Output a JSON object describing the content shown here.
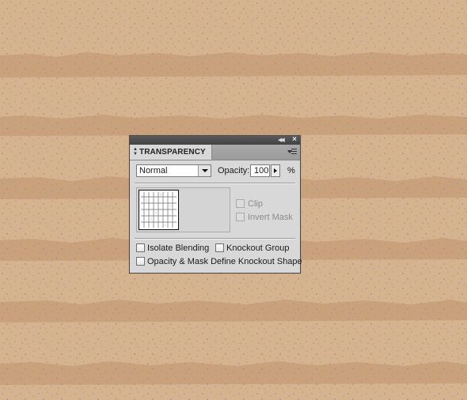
{
  "colors": {
    "background_sand": "#d6b38f",
    "background_stripe": "#c8a079",
    "speckle": "#9d8fa5",
    "panel_bg": "#d8d8d8",
    "title_bar": "#4a4a4a"
  },
  "panel": {
    "title": "TRANSPARENCY",
    "icons": {
      "collapse": "double-chevron-left-icon",
      "close": "close-icon",
      "menu": "panel-menu-icon",
      "tab_arrows": "up-down-arrows-icon"
    },
    "blend_mode": {
      "value": "Normal"
    },
    "opacity": {
      "label": "Opacity:",
      "value": "100",
      "unit": "%"
    },
    "mask_options": {
      "clip": {
        "label": "Clip",
        "checked": false,
        "enabled": false
      },
      "invert_mask": {
        "label": "Invert Mask",
        "checked": false,
        "enabled": false
      }
    },
    "options": {
      "isolate_blending": {
        "label": "Isolate Blending",
        "checked": false
      },
      "knockout_group": {
        "label": "Knockout Group",
        "checked": false
      },
      "opacity_mask_knockout": {
        "label": "Opacity & Mask Define Knockout Shape",
        "checked": false
      }
    }
  }
}
